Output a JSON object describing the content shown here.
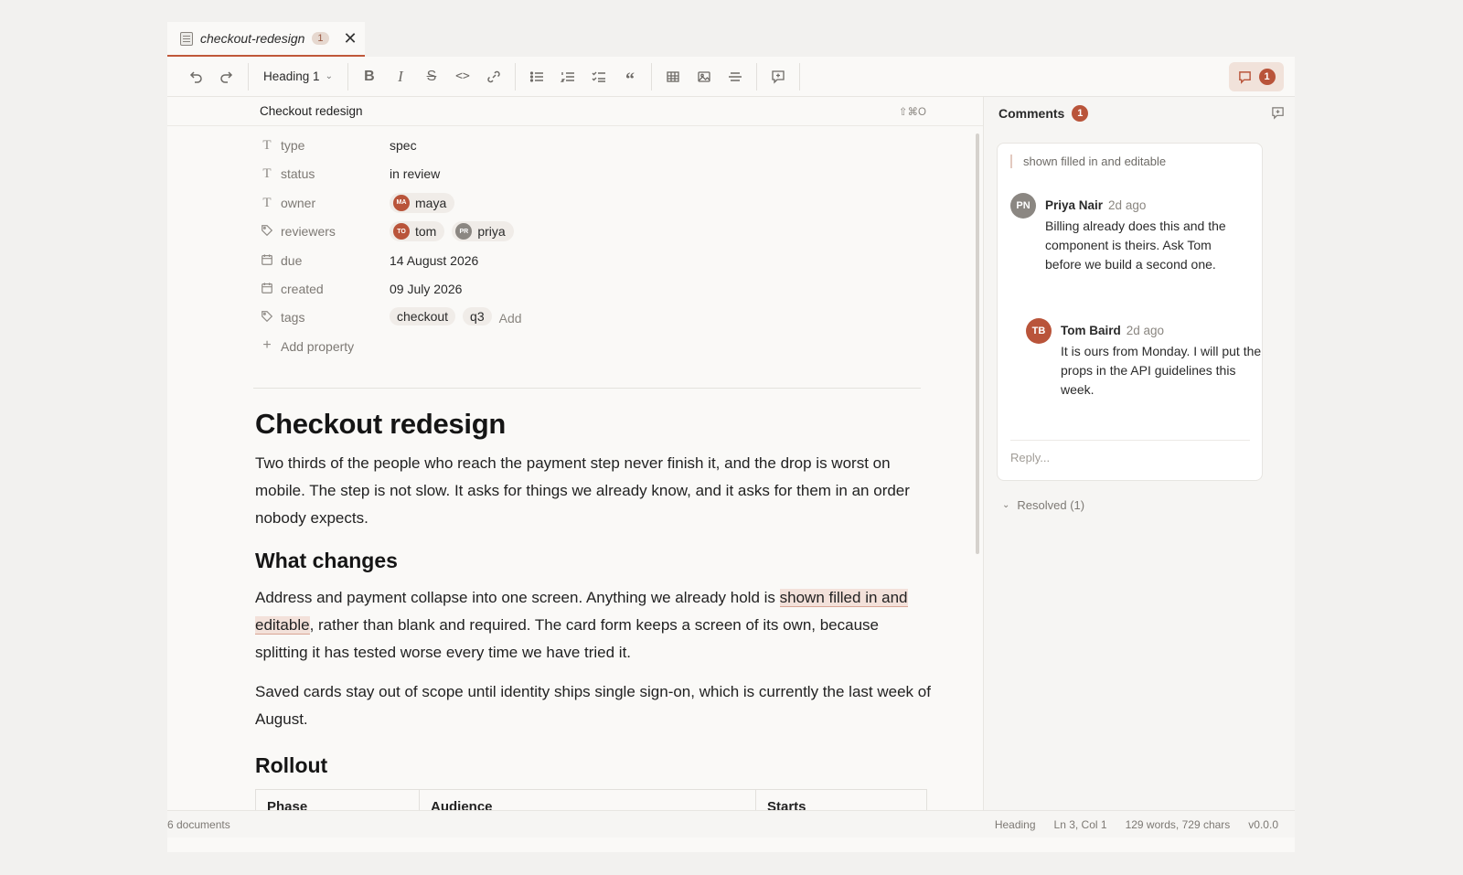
{
  "tab": {
    "title": "checkout-redesign",
    "badge": "1",
    "close": "✕"
  },
  "toolbar": {
    "block_type": "Heading 1",
    "comment_count": "1"
  },
  "editor": {
    "header_title": "Checkout redesign",
    "shortcut": "⇧⌘O"
  },
  "properties": {
    "type": {
      "key": "type",
      "value": "spec"
    },
    "status": {
      "key": "status",
      "value": "in review"
    },
    "owner": {
      "key": "owner",
      "initials": "MA",
      "name": "maya"
    },
    "reviewers": {
      "key": "reviewers",
      "people": [
        {
          "initials": "TO",
          "name": "tom"
        },
        {
          "initials": "PR",
          "name": "priya"
        }
      ]
    },
    "due": {
      "key": "due",
      "value": "14 August 2026"
    },
    "created": {
      "key": "created",
      "value": "09 July 2026"
    },
    "tags": {
      "key": "tags",
      "items": [
        "checkout",
        "q3"
      ],
      "add": "Add"
    },
    "add_property": "Add property"
  },
  "document": {
    "h1": "Checkout redesign",
    "p1": "Two thirds of the people who reach the payment step never finish it, and the drop is worst on mobile. The step is not slow. It asks for things we already know, and it asks for them in an order nobody expects.",
    "h2_changes": "What changes",
    "p2_before": "Address and payment collapse into one screen. Anything we already hold is ",
    "p2_highlight": "shown filled in and editable",
    "p2_after": ", rather than blank and required. The card form keeps a screen of its own, because splitting it has tested worse every time we have tried it.",
    "p3": "Saved cards stay out of scope until identity ships single sign-on, which is currently the last week of August.",
    "h2_rollout": "Rollout",
    "table_headers": [
      "Phase",
      "Audience",
      "Starts"
    ]
  },
  "comments_panel": {
    "title": "Comments",
    "count": "1",
    "quote": "shown filled in and editable",
    "comments": [
      {
        "initials": "PN",
        "author": "Priya Nair",
        "time": "2d ago",
        "body": "Billing already does this and the component is theirs. Ask Tom before we build a second one.",
        "color": "#8b8782"
      },
      {
        "initials": "TB",
        "author": "Tom Baird",
        "time": "2d ago",
        "body": "It is ours from Monday. I will put the props in the API guidelines this week.",
        "color": "#b9543a"
      }
    ],
    "reply_placeholder": "Reply...",
    "resolved": "Resolved (1)"
  },
  "statusbar": {
    "documents": "6 documents",
    "block": "Heading",
    "position": "Ln 3, Col 1",
    "counts": "129 words, 729 chars",
    "version": "v0.0.0"
  },
  "colors": {
    "accent": "#b9543a",
    "highlight": "#f3e1da"
  }
}
